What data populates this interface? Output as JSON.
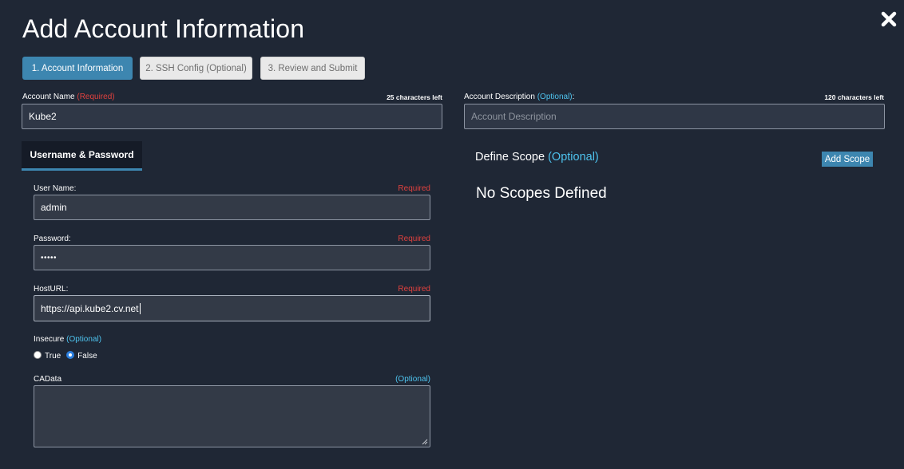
{
  "dialog": {
    "title": "Add Account Information",
    "close_icon": "close-icon"
  },
  "steps": [
    {
      "label": "1. Account Information",
      "active": true
    },
    {
      "label": "2. SSH Config (Optional)",
      "active": false
    },
    {
      "label": "3. Review and Submit",
      "active": false
    }
  ],
  "account_name": {
    "label": "Account Name",
    "required_text": "(Required)",
    "chars_left": "25 characters left",
    "value": "Kube2"
  },
  "account_description": {
    "label": "Account Description",
    "optional_text": "(Optional)",
    "colon": ":",
    "chars_left": "120 characters left",
    "placeholder": "Account Description"
  },
  "auth_tab": {
    "label": "Username & Password"
  },
  "username": {
    "label": "User Name:",
    "required_text": "Required",
    "value": "admin"
  },
  "password": {
    "label": "Password:",
    "required_text": "Required",
    "value": "•••••"
  },
  "hosturl": {
    "label": "HostURL:",
    "required_text": "Required",
    "value": "https://api.kube2.cv.net"
  },
  "insecure": {
    "label": "Insecure",
    "optional_text": "(Optional)",
    "options": [
      {
        "label": "True",
        "selected": false
      },
      {
        "label": "False",
        "selected": true
      }
    ]
  },
  "cadata": {
    "label": "CAData",
    "optional_text": "(Optional)",
    "value": ""
  },
  "scope": {
    "title": "Define Scope",
    "optional_text": "(Optional)",
    "add_button": "Add Scope",
    "empty_message": "No Scopes Defined"
  },
  "colors": {
    "background": "#1f2735",
    "accent": "#3d86b0",
    "required": "#e0413e",
    "optional": "#4ec3ee"
  }
}
